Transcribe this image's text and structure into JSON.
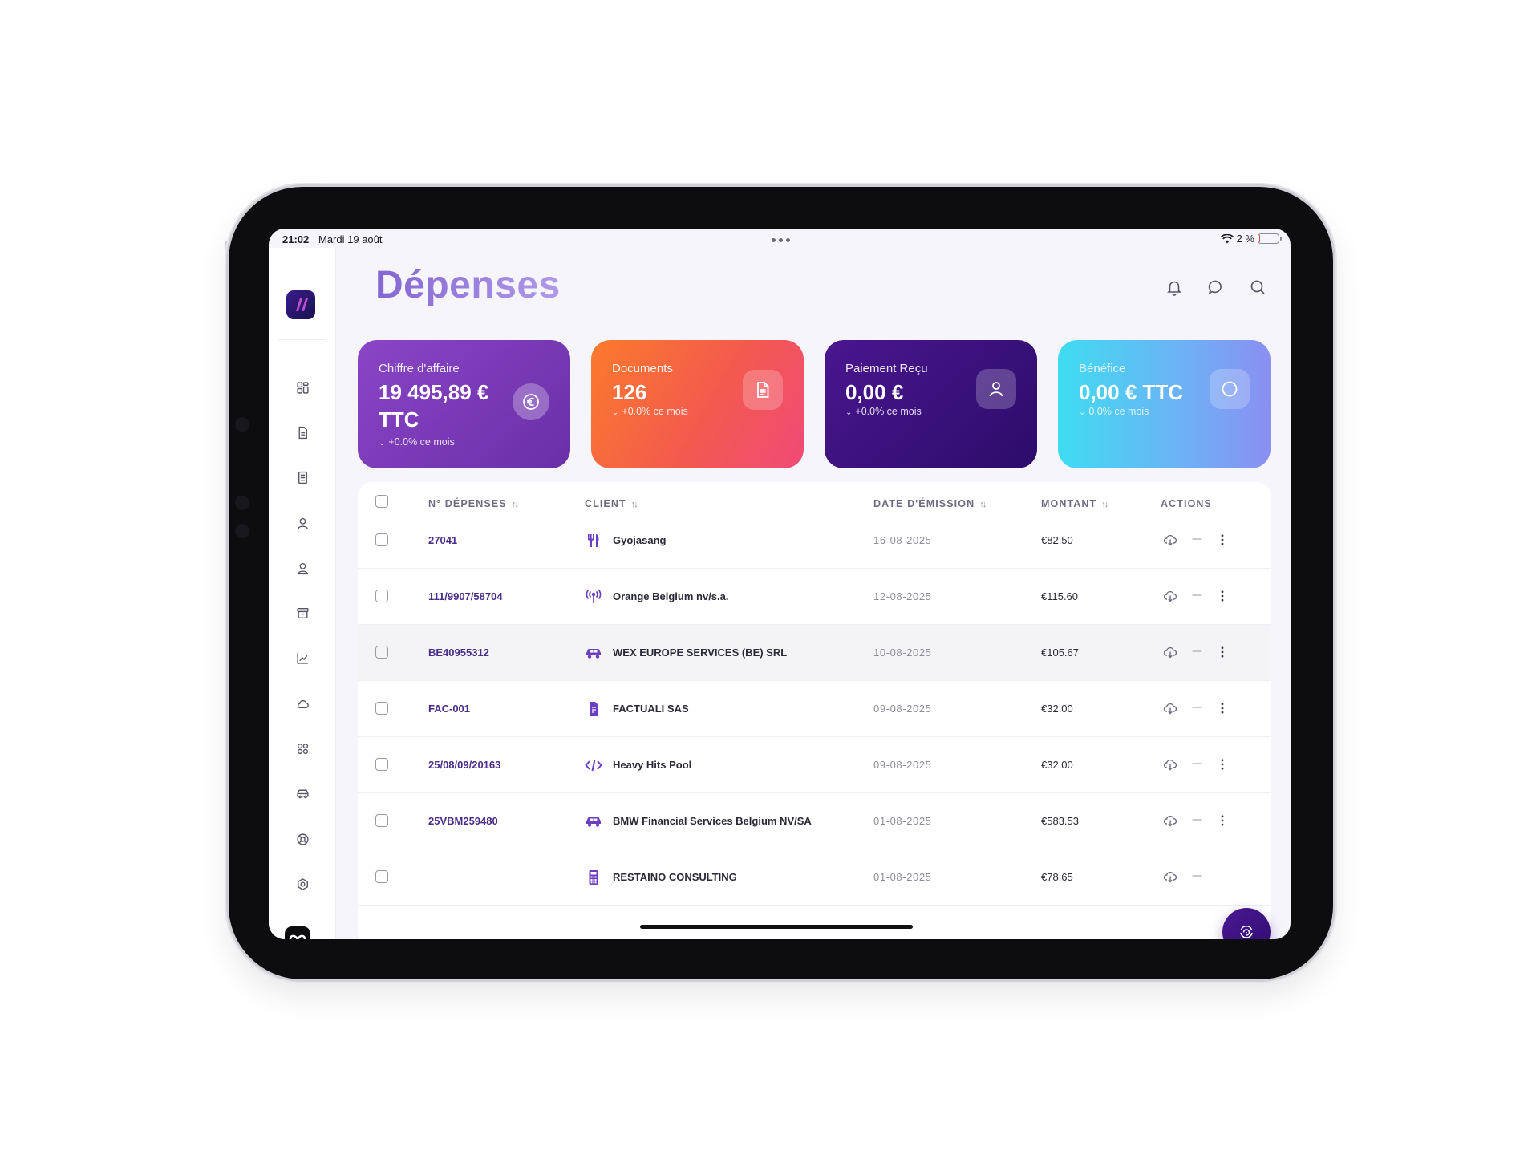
{
  "statusbar": {
    "time": "21:02",
    "date": "Mardi 19 août",
    "battery": "2 %",
    "battery_level": 0.02
  },
  "page": {
    "title": "Dépenses"
  },
  "header": {
    "icons": [
      "bell-icon",
      "chat-icon",
      "search-icon"
    ]
  },
  "sidebar": {
    "icons": [
      "grid-icon",
      "document-icon",
      "list-document-icon",
      "user-icon",
      "user-alt-icon",
      "archive-icon",
      "chart-icon",
      "cloud-icon",
      "apps-icon",
      "car-icon",
      "help-icon",
      "settings-icon"
    ]
  },
  "kpis": [
    {
      "label": "Chiffre d'affaire",
      "value": "19 495,89 € TTC",
      "delta": "+0.0% ce mois",
      "icon": "euro-icon"
    },
    {
      "label": "Documents",
      "value": "126",
      "delta": "+0.0% ce mois",
      "icon": "document-icon"
    },
    {
      "label": "Paiement Reçu",
      "value": "0,00 €",
      "delta": "+0.0% ce mois",
      "icon": "user-icon"
    },
    {
      "label": "Bénéfice",
      "value": "0,00 € TTC",
      "delta": "0.0% ce mois",
      "icon": "circle-icon"
    }
  ],
  "table": {
    "columns": {
      "number": "N° DÉPENSES",
      "client": "CLIENT",
      "date": "DATE D'ÉMISSION",
      "amount": "MONTANT",
      "actions": "ACTIONS"
    },
    "rows": [
      {
        "number": "27041",
        "client": "Gyojasang",
        "client_icon": "restaurant-icon",
        "date": "16-08-2025",
        "amount": "€82.50"
      },
      {
        "number": "111/9907/58704",
        "client": "Orange Belgium nv/s.a.",
        "client_icon": "antenna-icon",
        "date": "12-08-2025",
        "amount": "€115.60"
      },
      {
        "number": "BE40955312",
        "client": "WEX EUROPE SERVICES (BE) SRL",
        "client_icon": "car-icon",
        "date": "10-08-2025",
        "amount": "€105.67"
      },
      {
        "number": "FAC-001",
        "client": "FACTUALI SAS",
        "client_icon": "file-invoice-icon",
        "date": "09-08-2025",
        "amount": "€32.00"
      },
      {
        "number": "25/08/09/20163",
        "client": "Heavy Hits Pool",
        "client_icon": "code-icon",
        "date": "09-08-2025",
        "amount": "€32.00"
      },
      {
        "number": "25VBM259480",
        "client": "BMW Financial Services Belgium NV/SA",
        "client_icon": "car-icon",
        "date": "01-08-2025",
        "amount": "€583.53"
      },
      {
        "number": "",
        "client": "RESTAINO CONSULTING",
        "client_icon": "calculator-icon",
        "date": "01-08-2025",
        "amount": "€78.65"
      }
    ]
  },
  "colors": {
    "accent": "#6b3fc0",
    "brand_dark": "#2e0c6e",
    "title": "#8b6fd6"
  }
}
